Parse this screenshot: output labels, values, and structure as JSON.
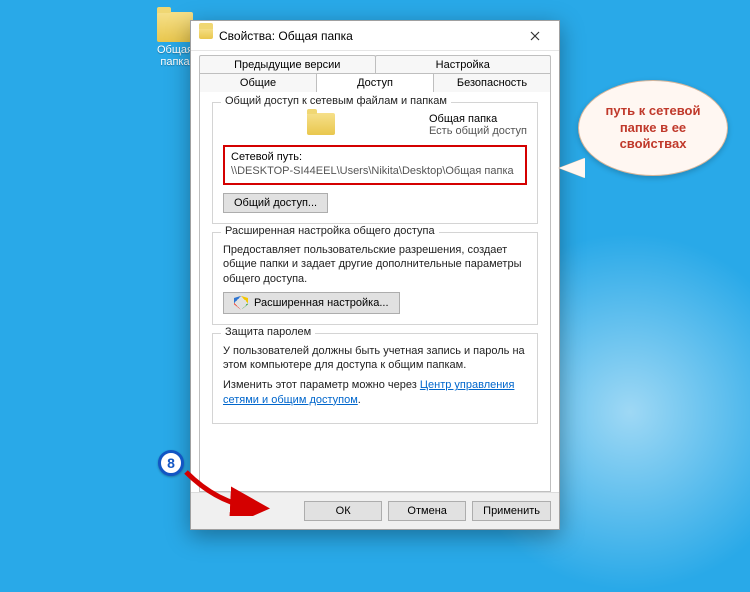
{
  "desktop": {
    "icon_label": "Общая\nпапка"
  },
  "dialog": {
    "title": "Свойства: Общая папка",
    "tabs_top": [
      "Предыдущие версии",
      "Настройка"
    ],
    "tabs_bottom": [
      "Общие",
      "Доступ",
      "Безопасность"
    ],
    "active_tab_index": 1,
    "share": {
      "group_title": "Общий доступ к сетевым файлам и папкам",
      "folder_name": "Общая папка",
      "status": "Есть общий доступ",
      "path_label": "Сетевой путь:",
      "path_value": "\\\\DESKTOP-SI44EEL\\Users\\Nikita\\Desktop\\Общая папка",
      "share_btn": "Общий доступ..."
    },
    "advanced": {
      "group_title": "Расширенная настройка общего доступа",
      "desc": "Предоставляет пользовательские разрешения, создает общие папки и задает другие дополнительные параметры общего доступа.",
      "btn": "Расширенная настройка..."
    },
    "password": {
      "group_title": "Защита паролем",
      "desc": "У пользователей должны быть учетная запись и пароль на этом компьютере для доступа к общим папкам.",
      "hint_prefix": "Изменить этот параметр можно через ",
      "link": "Центр управления сетями и общим доступом",
      "hint_suffix": "."
    },
    "footer": {
      "ok": "ОК",
      "cancel": "Отмена",
      "apply": "Применить"
    }
  },
  "annotations": {
    "callout": "путь к сетевой папке в ее свойствах",
    "step_number": "8"
  }
}
